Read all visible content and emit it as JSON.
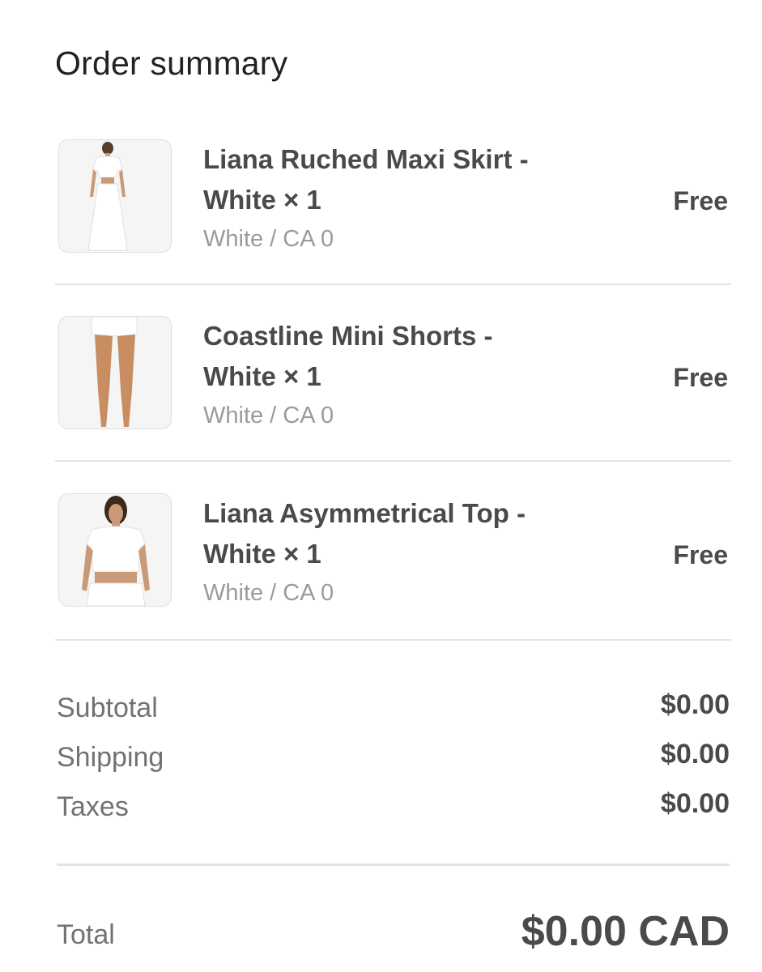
{
  "title": "Order summary",
  "items": [
    {
      "name_line1": "Liana Ruched Maxi Skirt -",
      "name_line2": "White × 1",
      "variant": "White / CA 0",
      "price": "Free",
      "image": "model-white-maxi-skirt-image"
    },
    {
      "name_line1": "Coastline Mini Shorts -",
      "name_line2": "White × 1",
      "variant": "White / CA 0",
      "price": "Free",
      "image": "model-white-mini-shorts-image"
    },
    {
      "name_line1": "Liana Asymmetrical Top -",
      "name_line2": "White × 1",
      "variant": "White / CA 0",
      "price": "Free",
      "image": "model-white-top-image"
    }
  ],
  "summary": {
    "subtotal_label": "Subtotal",
    "subtotal_value": "$0.00",
    "shipping_label": "Shipping",
    "shipping_value": "$0.00",
    "taxes_label": "Taxes",
    "taxes_value": "$0.00"
  },
  "total": {
    "label": "Total",
    "value": "$0.00 CAD"
  },
  "colors": {
    "text_dark": "#4a4a4a",
    "text_muted": "#9b9b9b",
    "divider": "#e4e4e4"
  }
}
